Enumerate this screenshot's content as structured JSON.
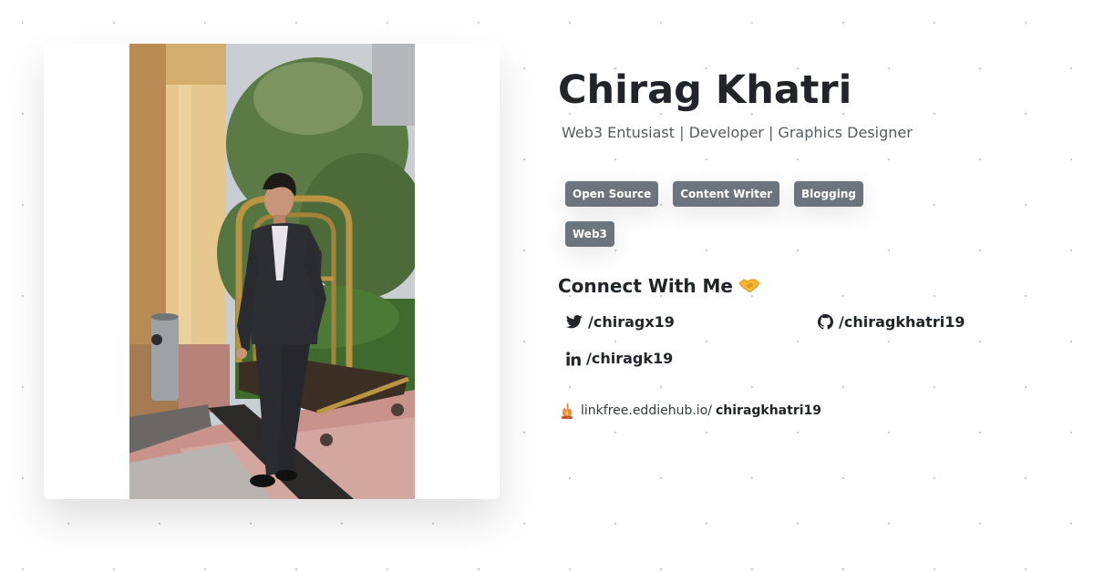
{
  "profile": {
    "name": "Chirag Khatri",
    "tagline": "Web3 Entusiast | Developer | Graphics Designer",
    "photo_icon": "profile-photo",
    "tags": [
      "Open Source",
      "Content Writer",
      "Blogging",
      "Web3"
    ]
  },
  "connect": {
    "heading": "Connect With Me",
    "heading_emoji": "handshake-icon",
    "links": {
      "twitter": {
        "icon": "twitter-icon",
        "label": "/chiragx19"
      },
      "github": {
        "icon": "github-icon",
        "label": "/chiragkhatri19"
      },
      "linkedin": {
        "icon": "linkedin-icon",
        "label": "/chiragk19"
      }
    }
  },
  "linkfree": {
    "icon": "linkfree-logo-icon",
    "host": "linkfree.eddiehub.io/",
    "username": "chiragkhatri19"
  },
  "colors": {
    "tag_background": "#6c757d",
    "text": "#212529",
    "muted_text": "#555b61",
    "page_background": "#ffffff"
  }
}
